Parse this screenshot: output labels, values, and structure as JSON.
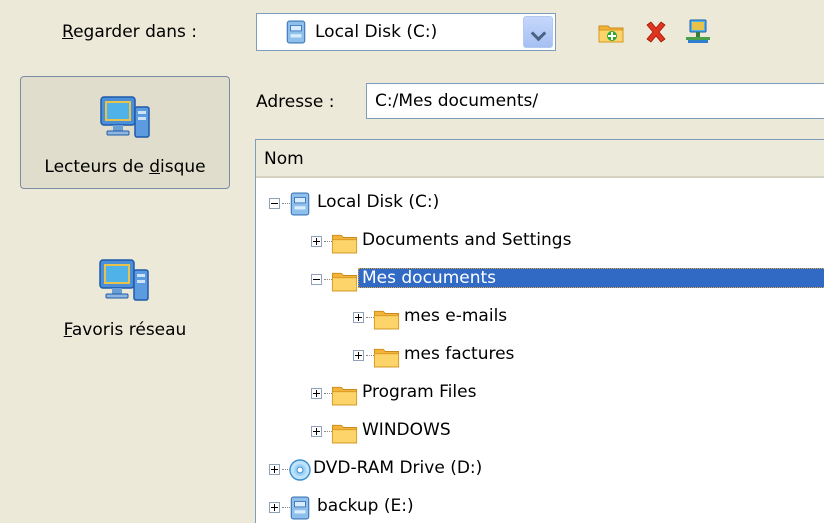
{
  "look_in": {
    "label_underlined": "R",
    "label_rest": "egarder dans :",
    "selected": "Local Disk (C:)"
  },
  "toolbar": {
    "icons": [
      "new-folder-icon",
      "delete-icon",
      "network-drive-icon"
    ]
  },
  "places": {
    "disks_label_pre": "Lecteurs de ",
    "disks_label_ul": "d",
    "disks_label_post": "isque",
    "network_label_ul": "F",
    "network_label_rest": "avoris réseau"
  },
  "address": {
    "label": "Adresse :",
    "value": "C:/Mes documents/"
  },
  "tree": {
    "header": "Nom",
    "items": {
      "local_disk": "Local Disk (C:)",
      "documents_settings": "Documents and Settings",
      "mes_documents": "Mes documents",
      "mes_emails": "mes e-mails",
      "mes_factures": "mes factures",
      "program_files": "Program Files",
      "windows": "WINDOWS",
      "dvd_ram": "DVD-RAM Drive (D:)",
      "backup": "backup (E:)"
    }
  },
  "colors": {
    "selection": "#316ac5",
    "folder": "#f7c34a",
    "window_bg": "#ece9d8"
  }
}
